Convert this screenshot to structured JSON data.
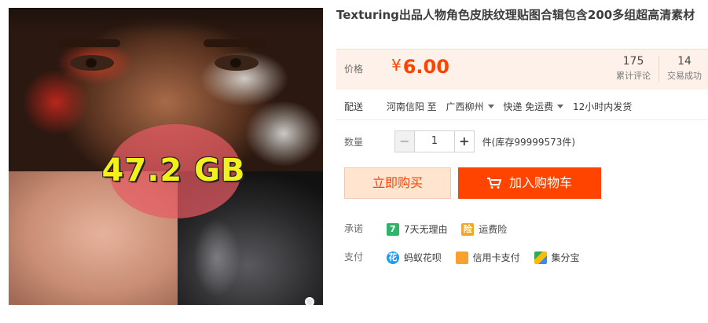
{
  "product": {
    "title": "Texturing出品人物角色皮肤纹理贴图合辑包含200多组超高清素材",
    "image_overlay_text": "47.2 GB"
  },
  "price": {
    "label": "价格",
    "currency": "¥",
    "value": "6.00",
    "color": "#ff4400"
  },
  "stats": {
    "reviews_count": "175",
    "reviews_label": "累计评论",
    "sales_count": "14",
    "sales_label": "交易成功"
  },
  "shipping": {
    "label": "配送",
    "from": "河南信阳 至",
    "to": "广西柳州",
    "method": "快递 免运费",
    "dispatch": "12小时内发货"
  },
  "quantity": {
    "label": "数量",
    "minus": "−",
    "value": "1",
    "plus": "+",
    "stock_text": "件(库存99999573件)"
  },
  "actions": {
    "buy_now": "立即购买",
    "add_to_cart": "加入购物车"
  },
  "promise": {
    "label": "承诺",
    "items": [
      {
        "icon": "seven-day-icon",
        "glyph": "7",
        "text": "7天无理由"
      },
      {
        "icon": "shipping-insurance-icon",
        "glyph": "险",
        "text": "运费险"
      }
    ]
  },
  "payment": {
    "label": "支付",
    "items": [
      {
        "icon": "huabei-icon",
        "glyph": "花",
        "text": "蚂蚁花呗"
      },
      {
        "icon": "credit-card-icon",
        "glyph": "",
        "text": "信用卡支付"
      },
      {
        "icon": "jifenbao-icon",
        "glyph": "",
        "text": "集分宝"
      }
    ]
  }
}
